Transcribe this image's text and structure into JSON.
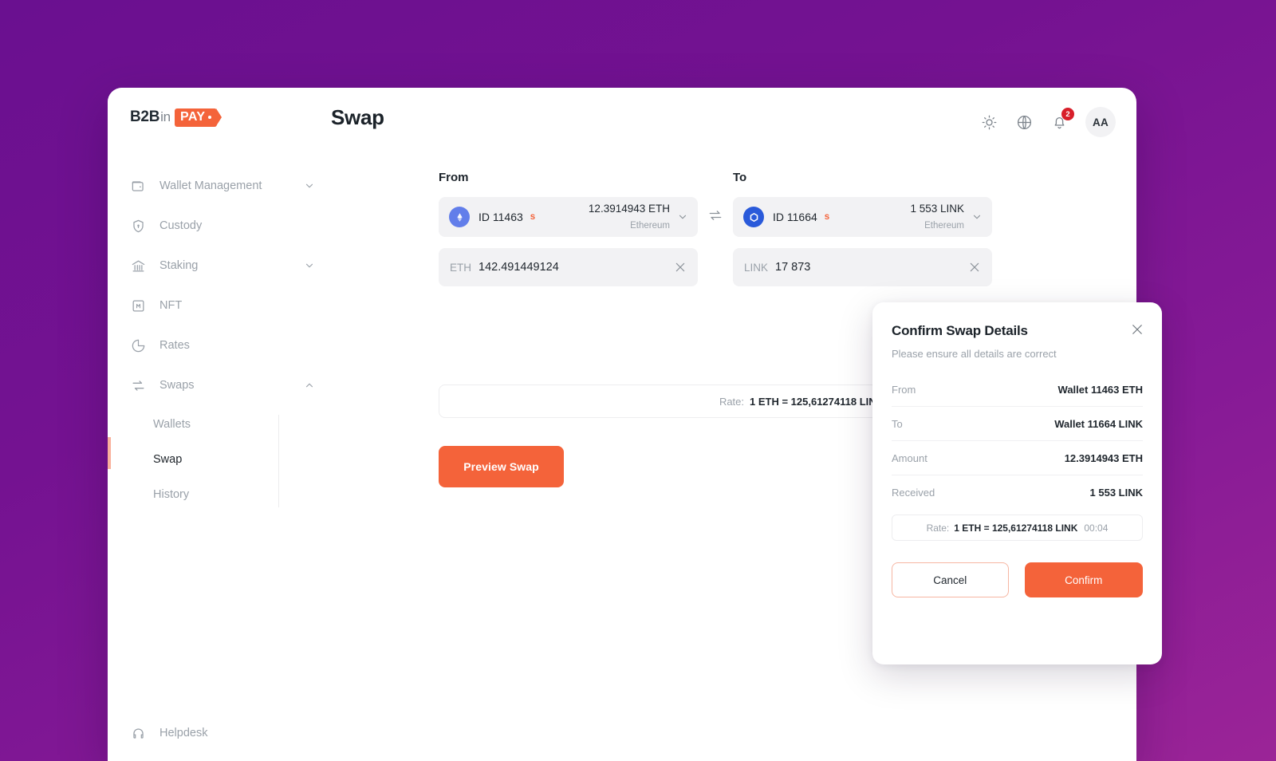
{
  "brand": {
    "logo_b2b": "B2B",
    "logo_in": "in",
    "logo_pay": "PAY"
  },
  "header": {
    "title": "Swap",
    "avatar_initials": "AA",
    "notification_count": "2",
    "icons": [
      "sun-icon",
      "globe-icon",
      "bell-icon"
    ]
  },
  "sidebar": {
    "items": [
      {
        "label": "Wallet Management",
        "icon": "wallet-icon",
        "expandable": true,
        "expanded": false
      },
      {
        "label": "Custody",
        "icon": "shield-icon",
        "expandable": false
      },
      {
        "label": "Staking",
        "icon": "bank-icon",
        "expandable": true,
        "expanded": false
      },
      {
        "label": "NFT",
        "icon": "nft-icon",
        "expandable": false
      },
      {
        "label": "Rates",
        "icon": "pie-chart-icon",
        "expandable": false
      },
      {
        "label": "Swaps",
        "icon": "swap-loop-icon",
        "expandable": true,
        "expanded": true
      }
    ],
    "submenu": [
      {
        "label": "Wallets",
        "active": false
      },
      {
        "label": "Swap",
        "active": true
      },
      {
        "label": "History",
        "active": false
      }
    ],
    "helpdesk": {
      "label": "Helpdesk",
      "icon": "headset-icon"
    }
  },
  "swap_form": {
    "from_label": "From",
    "to_label": "To",
    "from": {
      "wallet_id": "ID 11463",
      "badge": "s",
      "balance": "12.3914943 ETH",
      "network": "Ethereum",
      "coin_icon": "ethereum-icon",
      "currency": "ETH",
      "amount": "142.491449124"
    },
    "to": {
      "wallet_id": "ID 11664",
      "badge": "s",
      "balance": "1 553 LINK",
      "network": "Ethereum",
      "coin_icon": "chainlink-icon",
      "currency": "LINK",
      "amount": "17 873"
    },
    "rate_label": "Rate:",
    "rate_value": "1 ETH = 125,61274118 LINK",
    "preview_button": "Preview Swap"
  },
  "modal": {
    "title": "Confirm Swap Details",
    "subtitle": "Please ensure all details are correct",
    "rows": [
      {
        "key": "From",
        "value": "Wallet 11463 ETH"
      },
      {
        "key": "To",
        "value": "Wallet 11664 LINK"
      },
      {
        "key": "Amount",
        "value": "12.3914943 ETH"
      },
      {
        "key": "Received",
        "value": "1 553 LINK"
      }
    ],
    "rate_label": "Rate:",
    "rate_value": "1 ETH = 125,61274118 LINK",
    "rate_timer": "00:04",
    "cancel_button": "Cancel",
    "confirm_button": "Confirm"
  },
  "colors": {
    "accent": "#f4633a",
    "background_top": "#6a1090",
    "background_bottom": "#9b2497",
    "eth_blue": "#627eea",
    "link_blue": "#2a5ada",
    "badge_red": "#d81f2a"
  }
}
